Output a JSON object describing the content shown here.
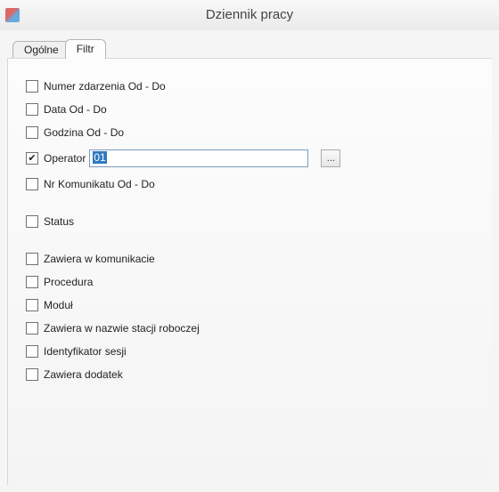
{
  "window": {
    "title": "Dziennik pracy"
  },
  "tabs": {
    "general_label": "Ogólne",
    "filter_label": "Filtr"
  },
  "filters": {
    "event_number": {
      "label": "Numer zdarzenia Od - Do",
      "checked": false
    },
    "date": {
      "label": "Data Od - Do",
      "checked": false
    },
    "time": {
      "label": "Godzina Od - Do",
      "checked": false
    },
    "operator": {
      "label": "Operator",
      "checked": true,
      "value": "01"
    },
    "msg_number": {
      "label": "Nr Komunikatu Od - Do",
      "checked": false
    },
    "status": {
      "label": "Status",
      "checked": false
    },
    "in_comm": {
      "label": "Zawiera w komunikacie",
      "checked": false
    },
    "procedure": {
      "label": "Procedura",
      "checked": false
    },
    "module": {
      "label": "Moduł",
      "checked": false
    },
    "workstation": {
      "label": "Zawiera w nazwie stacji roboczej",
      "checked": false
    },
    "session_id": {
      "label": "Identyfikator sesji",
      "checked": false
    },
    "addon": {
      "label": "Zawiera dodatek",
      "checked": false
    }
  },
  "buttons": {
    "ellipsis": "..."
  }
}
